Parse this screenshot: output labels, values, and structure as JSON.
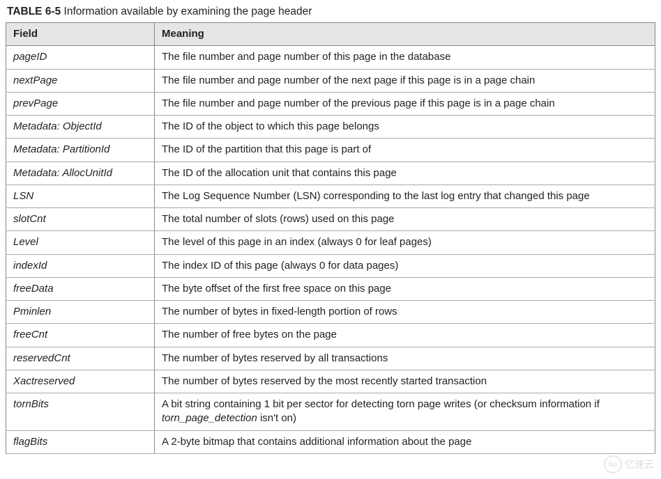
{
  "caption": {
    "label": "TABLE 6-5",
    "text": "Information available by examining the page header"
  },
  "columns": {
    "field": "Field",
    "meaning": "Meaning"
  },
  "rows": [
    {
      "field": "pageID",
      "meaning": "The file number and page number of this page in the database"
    },
    {
      "field": "nextPage",
      "meaning": "The file number and page number of the next page if this page is in a page chain"
    },
    {
      "field": "prevPage",
      "meaning": "The file number and page number of the previous page if this page is in a page chain"
    },
    {
      "field": "Metadata: ObjectId",
      "meaning": "The ID of the object to which this page belongs"
    },
    {
      "field": "Metadata: PartitionId",
      "meaning": "The ID of the partition that this page is part of"
    },
    {
      "field": "Metadata: AllocUnitId",
      "meaning": "The ID of the allocation unit that contains this page"
    },
    {
      "field": "LSN",
      "meaning": "The Log Sequence Number (LSN) corresponding to the last log entry that changed this page"
    },
    {
      "field": "slotCnt",
      "meaning": "The total number of slots (rows) used on this page"
    },
    {
      "field": "Level",
      "meaning": "The level of this page in an index (always 0 for leaf pages)"
    },
    {
      "field": "indexId",
      "meaning": "The index ID of this page (always 0 for data pages)"
    },
    {
      "field": "freeData",
      "meaning": "The byte offset of the first free space on this page"
    },
    {
      "field": "Pminlen",
      "meaning": "The number of bytes in fixed-length portion of rows"
    },
    {
      "field": "freeCnt",
      "meaning": "The number of free bytes on the page"
    },
    {
      "field": "reservedCnt",
      "meaning": "The number of bytes reserved by all transactions"
    },
    {
      "field": "Xactreserved",
      "meaning": "The number of bytes reserved by the most recently started transaction"
    },
    {
      "field": "tornBits",
      "meaning_html": "A bit string containing 1 bit per sector for detecting torn page writes (or checksum information if <span class=\"em\">torn_page_detection</span> isn't on)"
    },
    {
      "field": "flagBits",
      "meaning": "A 2-byte bitmap that contains additional information about the page"
    }
  ],
  "watermark": {
    "logo": "6o",
    "text": "亿速云"
  }
}
